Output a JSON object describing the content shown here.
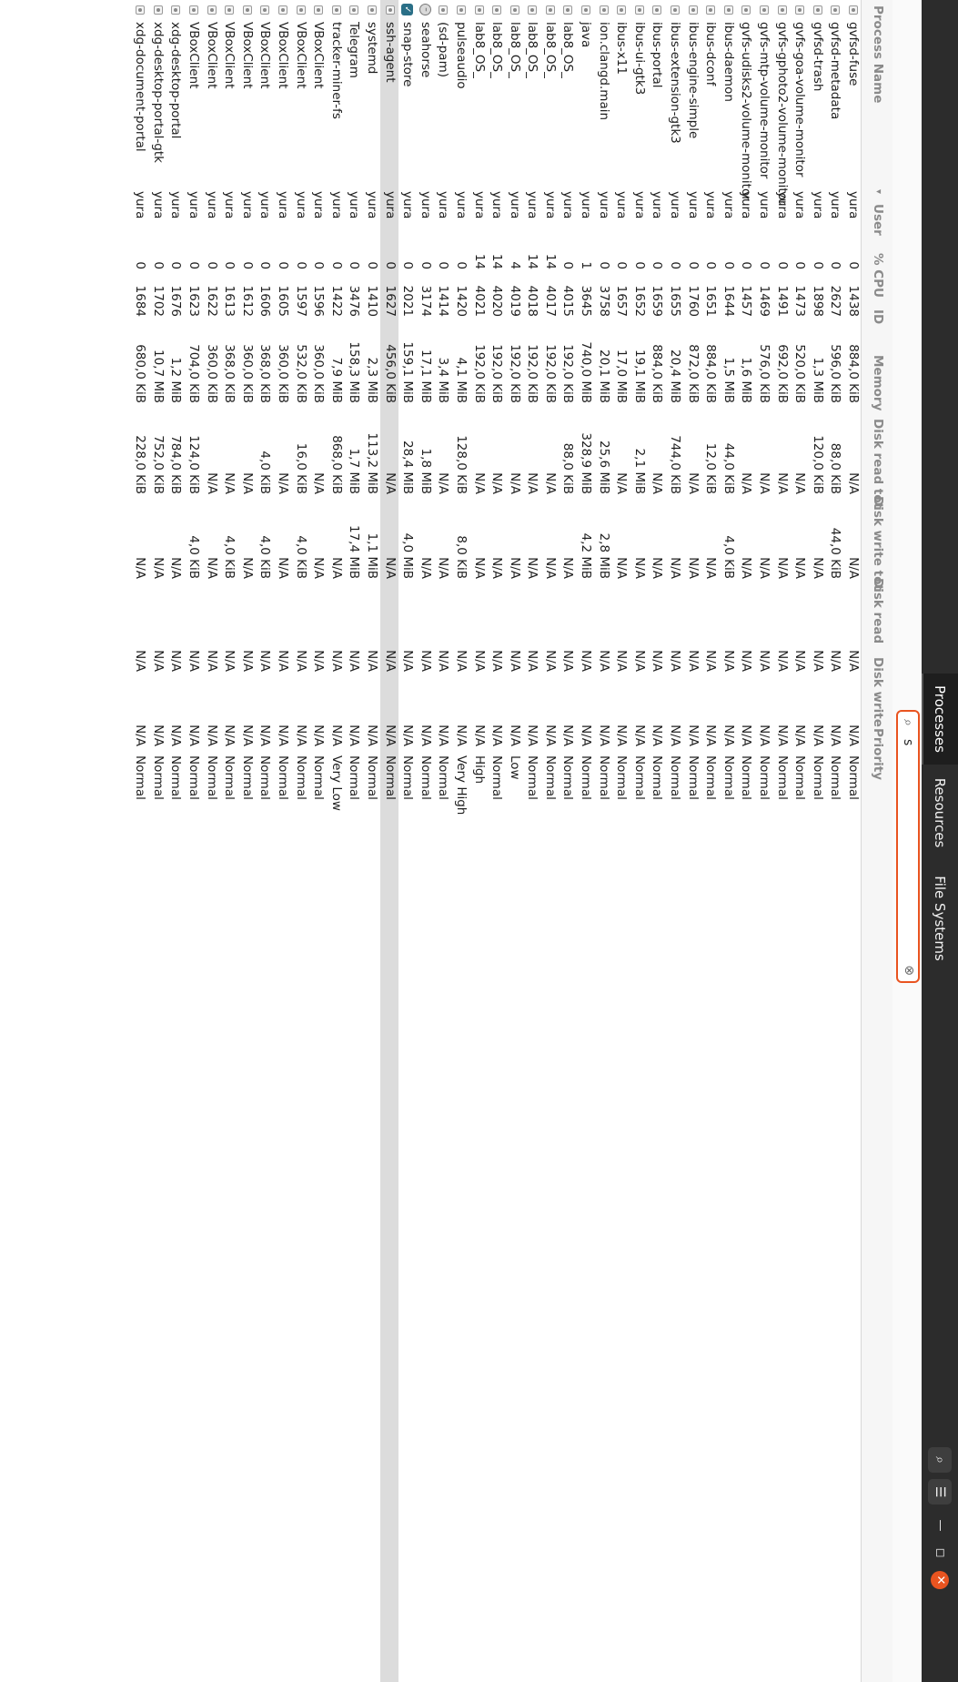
{
  "header": {
    "tabs": [
      {
        "label": "Processes",
        "active": true
      },
      {
        "label": "Resources",
        "active": false
      },
      {
        "label": "File Systems",
        "active": false
      }
    ],
    "icons": [
      "search-icon",
      "menu-icon",
      "minimize-icon",
      "maximize-icon",
      "close-icon"
    ],
    "minimize_glyph": "—",
    "maximize_glyph": "◻",
    "close_glyph": "✕",
    "menu_glyph": "☰",
    "search_glyph": "⌕"
  },
  "search": {
    "value": "s",
    "icon": "search-icon",
    "clear_icon": "clear-icon",
    "accent_color": "#e95420"
  },
  "columns": {
    "name": "Process Name",
    "user": "User",
    "sort_glyph": "▾",
    "cpu": "% CPU",
    "id": "ID",
    "memory": "Memory",
    "disk_read_total": "Disk read tot",
    "disk_write_total": "Disk write tot",
    "disk_read": "Disk read",
    "disk_write": "Disk write",
    "priority": "Priority"
  },
  "rows": [
    {
      "name": "gvfsd-fuse",
      "user": "yura",
      "cpu": "0",
      "id": "1438",
      "memory": "884,0 KiB",
      "dr_total": "N/A",
      "dw_total": "N/A",
      "dr": "N/A",
      "dw": "N/A",
      "priority": "Normal"
    },
    {
      "name": "gvfsd-metadata",
      "user": "yura",
      "cpu": "0",
      "id": "2627",
      "memory": "596,0 KiB",
      "dr_total": "88,0 KiB",
      "dw_total": "44,0 KiB",
      "dr": "N/A",
      "dw": "N/A",
      "priority": "Normal"
    },
    {
      "name": "gvfsd-trash",
      "user": "yura",
      "cpu": "0",
      "id": "1898",
      "memory": "1,3 MiB",
      "dr_total": "120,0 KiB",
      "dw_total": "N/A",
      "dr": "N/A",
      "dw": "N/A",
      "priority": "Normal"
    },
    {
      "name": "gvfs-goa-volume-monitor",
      "user": "yura",
      "cpu": "0",
      "id": "1473",
      "memory": "520,0 KiB",
      "dr_total": "N/A",
      "dw_total": "N/A",
      "dr": "N/A",
      "dw": "N/A",
      "priority": "Normal"
    },
    {
      "name": "gvfs-gphoto2-volume-monitor",
      "user": "yura",
      "cpu": "0",
      "id": "1491",
      "memory": "692,0 KiB",
      "dr_total": "N/A",
      "dw_total": "N/A",
      "dr": "N/A",
      "dw": "N/A",
      "priority": "Normal"
    },
    {
      "name": "gvfs-mtp-volume-monitor",
      "user": "yura",
      "cpu": "0",
      "id": "1469",
      "memory": "576,0 KiB",
      "dr_total": "N/A",
      "dw_total": "N/A",
      "dr": "N/A",
      "dw": "N/A",
      "priority": "Normal"
    },
    {
      "name": "gvfs-udisks2-volume-monitor",
      "user": "yura",
      "cpu": "0",
      "id": "1457",
      "memory": "1,6 MiB",
      "dr_total": "N/A",
      "dw_total": "N/A",
      "dr": "N/A",
      "dw": "N/A",
      "priority": "Normal"
    },
    {
      "name": "ibus-daemon",
      "user": "yura",
      "cpu": "0",
      "id": "1644",
      "memory": "1,5 MiB",
      "dr_total": "44,0 KiB",
      "dw_total": "4,0 KiB",
      "dr": "N/A",
      "dw": "N/A",
      "priority": "Normal"
    },
    {
      "name": "ibus-dconf",
      "user": "yura",
      "cpu": "0",
      "id": "1651",
      "memory": "884,0 KiB",
      "dr_total": "12,0 KiB",
      "dw_total": "N/A",
      "dr": "N/A",
      "dw": "N/A",
      "priority": "Normal"
    },
    {
      "name": "ibus-engine-simple",
      "user": "yura",
      "cpu": "0",
      "id": "1760",
      "memory": "872,0 KiB",
      "dr_total": "N/A",
      "dw_total": "N/A",
      "dr": "N/A",
      "dw": "N/A",
      "priority": "Normal"
    },
    {
      "name": "ibus-extension-gtk3",
      "user": "yura",
      "cpu": "0",
      "id": "1655",
      "memory": "20,4 MiB",
      "dr_total": "744,0 KiB",
      "dw_total": "N/A",
      "dr": "N/A",
      "dw": "N/A",
      "priority": "Normal"
    },
    {
      "name": "ibus-portal",
      "user": "yura",
      "cpu": "0",
      "id": "1659",
      "memory": "884,0 KiB",
      "dr_total": "N/A",
      "dw_total": "N/A",
      "dr": "N/A",
      "dw": "N/A",
      "priority": "Normal"
    },
    {
      "name": "ibus-ui-gtk3",
      "user": "yura",
      "cpu": "0",
      "id": "1652",
      "memory": "19,1 MiB",
      "dr_total": "2,1 MiB",
      "dw_total": "N/A",
      "dr": "N/A",
      "dw": "N/A",
      "priority": "Normal"
    },
    {
      "name": "ibus-x11",
      "user": "yura",
      "cpu": "0",
      "id": "1657",
      "memory": "17,0 MiB",
      "dr_total": "N/A",
      "dw_total": "N/A",
      "dr": "N/A",
      "dw": "N/A",
      "priority": "Normal"
    },
    {
      "name": "ion.clangd.main",
      "user": "yura",
      "cpu": "0",
      "id": "3758",
      "memory": "20,1 MiB",
      "dr_total": "25,6 MiB",
      "dw_total": "2,8 MiB",
      "dr": "N/A",
      "dw": "N/A",
      "priority": "Normal"
    },
    {
      "name": "java",
      "user": "yura",
      "cpu": "1",
      "id": "3645",
      "memory": "740,0 MiB",
      "dr_total": "328,9 MiB",
      "dw_total": "4,2 MiB",
      "dr": "N/A",
      "dw": "N/A",
      "priority": "Normal"
    },
    {
      "name": "lab8_OS_",
      "user": "yura",
      "cpu": "0",
      "id": "4015",
      "memory": "192,0 KiB",
      "dr_total": "88,0 KiB",
      "dw_total": "N/A",
      "dr": "N/A",
      "dw": "N/A",
      "priority": "Normal"
    },
    {
      "name": "lab8_OS_",
      "user": "yura",
      "cpu": "14",
      "id": "4017",
      "memory": "192,0 KiB",
      "dr_total": "N/A",
      "dw_total": "N/A",
      "dr": "N/A",
      "dw": "N/A",
      "priority": "Normal"
    },
    {
      "name": "lab8_OS_",
      "user": "yura",
      "cpu": "14",
      "id": "4018",
      "memory": "192,0 KiB",
      "dr_total": "N/A",
      "dw_total": "N/A",
      "dr": "N/A",
      "dw": "N/A",
      "priority": "Normal"
    },
    {
      "name": "lab8_OS_",
      "user": "yura",
      "cpu": "4",
      "id": "4019",
      "memory": "192,0 KiB",
      "dr_total": "N/A",
      "dw_total": "N/A",
      "dr": "N/A",
      "dw": "N/A",
      "priority": "Low"
    },
    {
      "name": "lab8_OS_",
      "user": "yura",
      "cpu": "14",
      "id": "4020",
      "memory": "192,0 KiB",
      "dr_total": "N/A",
      "dw_total": "N/A",
      "dr": "N/A",
      "dw": "N/A",
      "priority": "Normal"
    },
    {
      "name": "lab8_OS_",
      "user": "yura",
      "cpu": "14",
      "id": "4021",
      "memory": "192,0 KiB",
      "dr_total": "N/A",
      "dw_total": "N/A",
      "dr": "N/A",
      "dw": "N/A",
      "priority": "High"
    },
    {
      "name": "pulseaudio",
      "user": "yura",
      "cpu": "0",
      "id": "1420",
      "memory": "4,1 MiB",
      "dr_total": "128,0 KiB",
      "dw_total": "8,0 KiB",
      "dr": "N/A",
      "dw": "N/A",
      "priority": "Very High"
    },
    {
      "name": "(sd-pam)",
      "user": "yura",
      "cpu": "0",
      "id": "1414",
      "memory": "3,4 MiB",
      "dr_total": "N/A",
      "dw_total": "N/A",
      "dr": "N/A",
      "dw": "N/A",
      "priority": "Normal"
    },
    {
      "name": "seahorse",
      "user": "yura",
      "cpu": "0",
      "id": "3174",
      "memory": "17,1 MiB",
      "dr_total": "1,8 MiB",
      "dw_total": "N/A",
      "dr": "N/A",
      "dw": "N/A",
      "priority": "Normal",
      "icon": "collapse"
    },
    {
      "name": "snap-store",
      "user": "yura",
      "cpu": "0",
      "id": "2021",
      "memory": "159,1 MiB",
      "dr_total": "28,4 MiB",
      "dw_total": "4,0 MiB",
      "dr": "N/A",
      "dw": "N/A",
      "priority": "Normal",
      "icon": "check"
    },
    {
      "name": "ssh-agent",
      "user": "yura",
      "cpu": "0",
      "id": "1627",
      "memory": "456,0 KiB",
      "dr_total": "N/A",
      "dw_total": "N/A",
      "dr": "N/A",
      "dw": "N/A",
      "priority": "Normal",
      "selected": true
    },
    {
      "name": "systemd",
      "user": "yura",
      "cpu": "0",
      "id": "1410",
      "memory": "2,3 MiB",
      "dr_total": "113,2 MiB",
      "dw_total": "1,1 MiB",
      "dr": "N/A",
      "dw": "N/A",
      "priority": "Normal"
    },
    {
      "name": "Telegram",
      "user": "yura",
      "cpu": "0",
      "id": "3476",
      "memory": "158,3 MiB",
      "dr_total": "1,7 MiB",
      "dw_total": "17,4 MiB",
      "dr": "N/A",
      "dw": "N/A",
      "priority": "Normal"
    },
    {
      "name": "tracker-miner-fs",
      "user": "yura",
      "cpu": "0",
      "id": "1422",
      "memory": "7,9 MiB",
      "dr_total": "868,0 KiB",
      "dw_total": "N/A",
      "dr": "N/A",
      "dw": "N/A",
      "priority": "Very Low"
    },
    {
      "name": "VBoxClient",
      "user": "yura",
      "cpu": "0",
      "id": "1596",
      "memory": "360,0 KiB",
      "dr_total": "N/A",
      "dw_total": "N/A",
      "dr": "N/A",
      "dw": "N/A",
      "priority": "Normal"
    },
    {
      "name": "VBoxClient",
      "user": "yura",
      "cpu": "0",
      "id": "1597",
      "memory": "532,0 KiB",
      "dr_total": "16,0 KiB",
      "dw_total": "4,0 KiB",
      "dr": "N/A",
      "dw": "N/A",
      "priority": "Normal"
    },
    {
      "name": "VBoxClient",
      "user": "yura",
      "cpu": "0",
      "id": "1605",
      "memory": "360,0 KiB",
      "dr_total": "N/A",
      "dw_total": "N/A",
      "dr": "N/A",
      "dw": "N/A",
      "priority": "Normal"
    },
    {
      "name": "VBoxClient",
      "user": "yura",
      "cpu": "0",
      "id": "1606",
      "memory": "368,0 KiB",
      "dr_total": "4,0 KiB",
      "dw_total": "4,0 KiB",
      "dr": "N/A",
      "dw": "N/A",
      "priority": "Normal"
    },
    {
      "name": "VBoxClient",
      "user": "yura",
      "cpu": "0",
      "id": "1612",
      "memory": "360,0 KiB",
      "dr_total": "N/A",
      "dw_total": "N/A",
      "dr": "N/A",
      "dw": "N/A",
      "priority": "Normal"
    },
    {
      "name": "VBoxClient",
      "user": "yura",
      "cpu": "0",
      "id": "1613",
      "memory": "368,0 KiB",
      "dr_total": "N/A",
      "dw_total": "4,0 KiB",
      "dr": "N/A",
      "dw": "N/A",
      "priority": "Normal"
    },
    {
      "name": "VBoxClient",
      "user": "yura",
      "cpu": "0",
      "id": "1622",
      "memory": "360,0 KiB",
      "dr_total": "N/A",
      "dw_total": "N/A",
      "dr": "N/A",
      "dw": "N/A",
      "priority": "Normal"
    },
    {
      "name": "VBoxClient",
      "user": "yura",
      "cpu": "0",
      "id": "1623",
      "memory": "704,0 KiB",
      "dr_total": "124,0 KiB",
      "dw_total": "4,0 KiB",
      "dr": "N/A",
      "dw": "N/A",
      "priority": "Normal"
    },
    {
      "name": "xdg-desktop-portal",
      "user": "yura",
      "cpu": "0",
      "id": "1676",
      "memory": "1,2 MiB",
      "dr_total": "784,0 KiB",
      "dw_total": "N/A",
      "dr": "N/A",
      "dw": "N/A",
      "priority": "Normal"
    },
    {
      "name": "xdg-desktop-portal-gtk",
      "user": "yura",
      "cpu": "0",
      "id": "1702",
      "memory": "10,7 MiB",
      "dr_total": "752,0 KiB",
      "dw_total": "N/A",
      "dr": "N/A",
      "dw": "N/A",
      "priority": "Normal"
    },
    {
      "name": "xdg-document-portal",
      "user": "yura",
      "cpu": "0",
      "id": "1684",
      "memory": "680,0 KiB",
      "dr_total": "228,0 KiB",
      "dw_total": "N/A",
      "dr": "N/A",
      "dw": "N/A",
      "priority": "Normal"
    }
  ]
}
